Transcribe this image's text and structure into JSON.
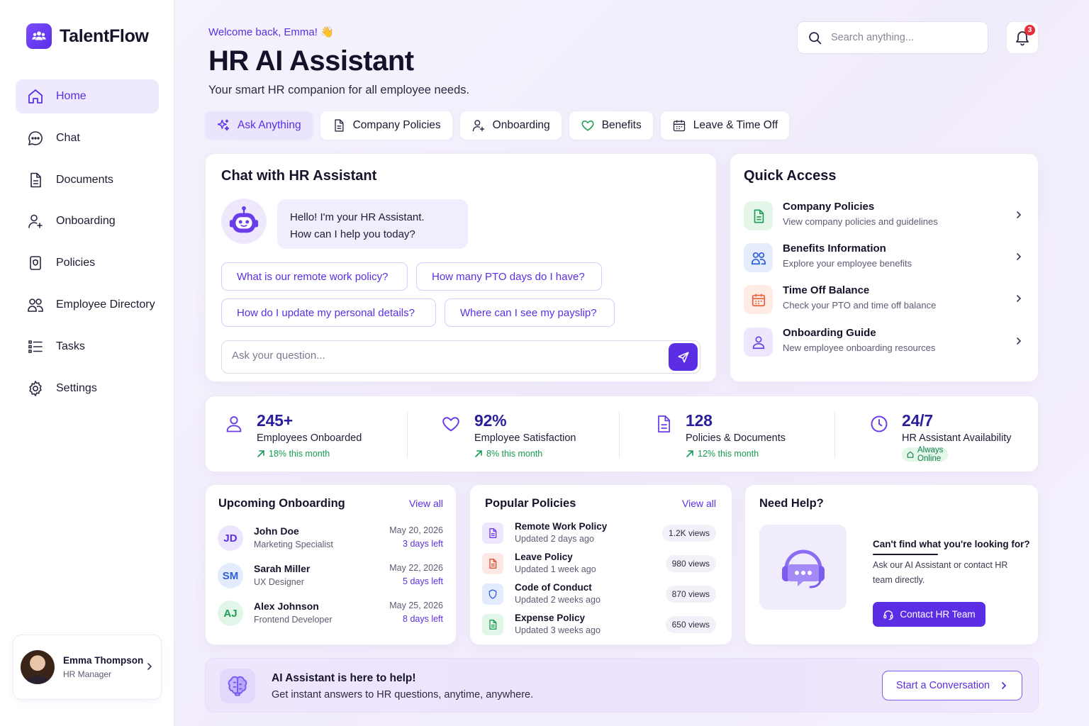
{
  "brand": {
    "name": "TalentFlow",
    "icon": "team-icon"
  },
  "sidebar": {
    "items": [
      {
        "label": "Home",
        "icon": "home-icon",
        "active": true
      },
      {
        "label": "Chat",
        "icon": "chat-icon"
      },
      {
        "label": "Documents",
        "icon": "document-icon"
      },
      {
        "label": "Onboarding",
        "icon": "user-plus-icon"
      },
      {
        "label": "Policies",
        "icon": "policy-icon"
      },
      {
        "label": "Employee Directory",
        "icon": "users-icon"
      },
      {
        "label": "Tasks",
        "icon": "tasks-icon"
      },
      {
        "label": "Settings",
        "icon": "gear-icon"
      }
    ],
    "profile": {
      "name": "Emma Thompson",
      "role": "HR Manager"
    }
  },
  "header": {
    "welcome": "Welcome back, Emma! 👋",
    "title": "HR AI Assistant",
    "subtitle": "Your smart HR companion for all employee needs.",
    "search_placeholder": "Search anything...",
    "notification_count": "3"
  },
  "tabs": [
    {
      "label": "Ask Anything",
      "icon": "sparkle-icon",
      "active": true
    },
    {
      "label": "Company Policies",
      "icon": "document-icon"
    },
    {
      "label": "Onboarding",
      "icon": "user-plus-icon"
    },
    {
      "label": "Benefits",
      "icon": "heart-icon"
    },
    {
      "label": "Leave & Time Off",
      "icon": "calendar-icon"
    }
  ],
  "chat": {
    "title": "Chat with HR Assistant",
    "greeting_line1": "Hello! I'm your HR Assistant.",
    "greeting_line2": "How can I help you today?",
    "suggestions": [
      "What is our remote work policy?",
      "How many PTO days do I have?",
      "How do I update my personal details?",
      "Where can I see my payslip?"
    ],
    "input_placeholder": "Ask your question..."
  },
  "quick_access": {
    "title": "Quick Access",
    "items": [
      {
        "title": "Company Policies",
        "desc": "View company policies and guidelines",
        "icon": "document-icon",
        "color": "#1f9d55"
      },
      {
        "title": "Benefits Information",
        "desc": "Explore your employee benefits",
        "icon": "users-icon",
        "color": "#2f5fd8"
      },
      {
        "title": "Time Off Balance",
        "desc": "Check your PTO and time off balance",
        "icon": "calendar-icon",
        "color": "#e8603c"
      },
      {
        "title": "Onboarding Guide",
        "desc": "New employee onboarding resources",
        "icon": "user-icon",
        "color": "#6a3de8"
      }
    ]
  },
  "stats": [
    {
      "value": "245+",
      "label": "Employees Onboarded",
      "trend": "18% this month",
      "icon": "user-icon"
    },
    {
      "value": "92%",
      "label": "Employee Satisfaction",
      "trend": "8% this month",
      "icon": "heart-icon"
    },
    {
      "value": "128",
      "label": "Policies & Documents",
      "trend": "12% this month",
      "icon": "document-icon"
    },
    {
      "value": "24/7",
      "label": "HR Assistant Availability",
      "trend": "Always Online",
      "icon": "clock-icon"
    }
  ],
  "onboarding": {
    "title": "Upcoming Onboarding",
    "view_all": "View all",
    "rows": [
      {
        "initials": "JD",
        "name": "John Doe",
        "role": "Marketing Specialist",
        "date": "May 20, 2026",
        "left": "3 days left"
      },
      {
        "initials": "SM",
        "name": "Sarah Miller",
        "role": "UX Designer",
        "date": "May 22, 2026",
        "left": "5 days left"
      },
      {
        "initials": "AJ",
        "name": "Alex Johnson",
        "role": "Frontend Developer",
        "date": "May 25, 2026",
        "left": "8 days left"
      }
    ]
  },
  "policies": {
    "title": "Popular Policies",
    "view_all": "View all",
    "rows": [
      {
        "name": "Remote Work Policy",
        "updated": "Updated 2 days ago",
        "views": "1.2K views",
        "color": "#6a3de8"
      },
      {
        "name": "Leave Policy",
        "updated": "Updated 1 week ago",
        "views": "980 views",
        "color": "#e0503a"
      },
      {
        "name": "Code of Conduct",
        "updated": "Updated 2 weeks ago",
        "views": "870 views",
        "color": "#2f5fd8"
      },
      {
        "name": "Expense Policy",
        "updated": "Updated 3 weeks ago",
        "views": "650 views",
        "color": "#1f9d55"
      }
    ]
  },
  "help": {
    "title": "Need Help?",
    "heading": "Can't find what you're looking for?",
    "text": "Ask our AI Assistant or contact HR team directly.",
    "button": "Contact HR Team"
  },
  "banner": {
    "title": "AI Assistant is here to help!",
    "subtitle": "Get instant answers to HR questions, anytime, anywhere.",
    "button": "Start a Conversation"
  }
}
